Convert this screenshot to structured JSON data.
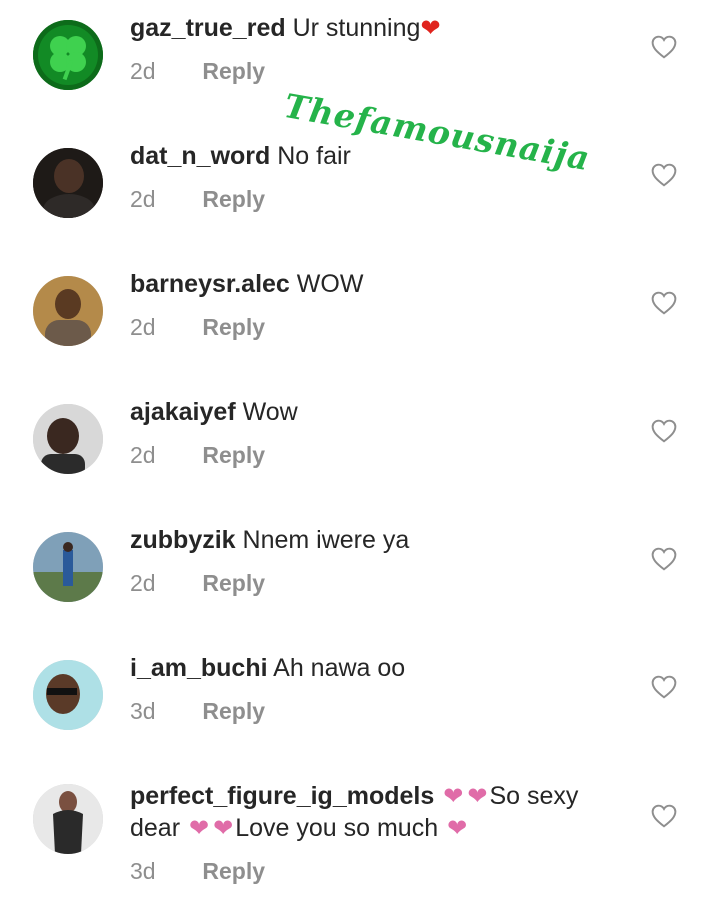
{
  "watermark": "Thefamousnaija",
  "comments": [
    {
      "username": "gaz_true_red",
      "text": "Ur stunning",
      "heart_end": "❤",
      "time": "2d",
      "reply": "Reply"
    },
    {
      "username": "dat_n_word",
      "text": "No fair",
      "time": "2d",
      "reply": "Reply"
    },
    {
      "username": "barneysr.alec",
      "text": "WOW",
      "time": "2d",
      "reply": "Reply"
    },
    {
      "username": "ajakaiyef",
      "text": "Wow",
      "time": "2d",
      "reply": "Reply"
    },
    {
      "username": "zubbyzik",
      "text": "Nnem iwere ya",
      "time": "2d",
      "reply": "Reply"
    },
    {
      "username": "i_am_buchi",
      "text": "Ah nawa oo",
      "time": "3d",
      "reply": "Reply"
    },
    {
      "username": "perfect_figure_ig_models",
      "text_part1": "So sexy",
      "text_line2_a": "dear",
      "text_part2": "Love you so much",
      "heart": "❤",
      "time": "3d",
      "reply": "Reply"
    }
  ],
  "colors": {
    "text": "#262626",
    "meta": "#8e8e8e",
    "heart_red": "#e0241e",
    "heart_pink": "#e06ca8",
    "watermark": "#25b34a"
  },
  "icons": {
    "like": "heart-outline-icon",
    "clover": "shamrock-icon"
  }
}
